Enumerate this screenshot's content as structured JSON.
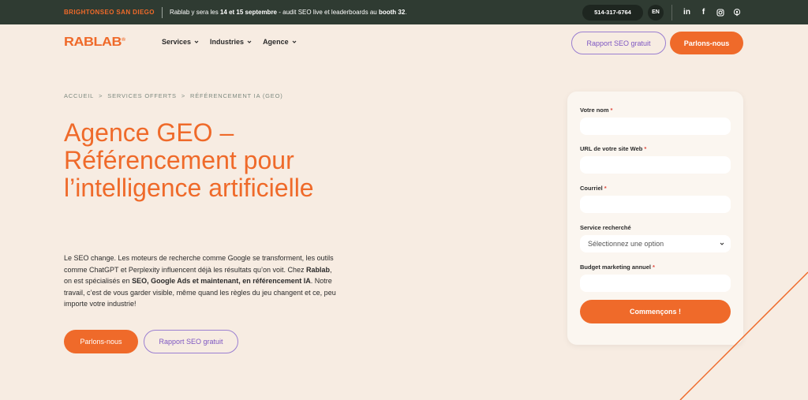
{
  "topbar": {
    "event_label": "BRIGHTONSEO SAN DIEGO",
    "announce_1": "Rablab y sera les ",
    "announce_bold_1": "14 et 15 septembre",
    "announce_2": " - audit SEO live et leaderboards  au ",
    "announce_bold_2": "booth 32",
    "announce_3": ".",
    "phone": "514-317-6764",
    "lang": "EN",
    "social_icons": [
      "linkedin-icon",
      "facebook-icon",
      "instagram-icon",
      "podcast-icon"
    ]
  },
  "header": {
    "logo": "RABLAB",
    "logo_sup": "®",
    "nav": [
      "Services",
      "Industries",
      "Agence"
    ],
    "btn_outline": "Rapport SEO gratuit",
    "btn_solid": "Parlons-nous"
  },
  "breadcrumb": [
    "ACCUEIL",
    ">",
    "SERVICES OFFERTS",
    ">",
    "RÉFÉRENCEMENT IA (GEO)"
  ],
  "hero": {
    "title": "Agence GEO – Référencement pour l’intelligence artificielle",
    "p1": "Le SEO change. Les moteurs de recherche comme Google se transforment, les outils comme ChatGPT et Perplexity influencent déjà les résultats qu’on voit. Chez ",
    "b1": "Rablab",
    "p2": ", on est spécialisés en ",
    "b2": "SEO, Google Ads et maintenant, en référencement IA",
    "p3": ". Notre travail, c’est de vous garder visible, même quand les règles du jeu changent et ce, peu importe votre industrie!",
    "cta_primary": "Parlons-nous",
    "cta_secondary": "Rapport SEO gratuit"
  },
  "form": {
    "fields": [
      {
        "label": "Votre nom",
        "required": "*"
      },
      {
        "label": "URL de votre site Web",
        "required": "*"
      },
      {
        "label": "Courriel",
        "required": "*"
      },
      {
        "label": "Service recherché",
        "required": ""
      },
      {
        "label": "Budget marketing annuel",
        "required": "*"
      }
    ],
    "select_value": "Sélectionnez une option",
    "submit": "Commençons !"
  },
  "colors": {
    "accent": "#ef6a2a",
    "dark": "#2f3b32",
    "purple": "#7d56c2",
    "background": "#f7ece2"
  }
}
